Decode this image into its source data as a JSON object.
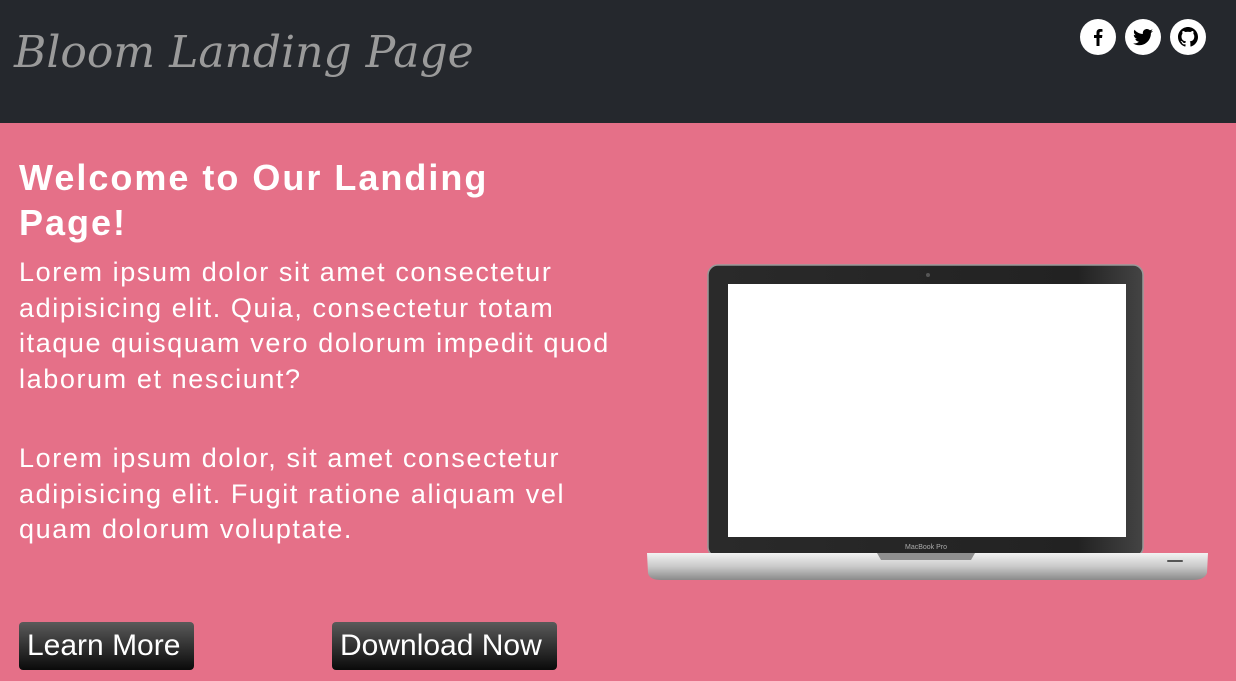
{
  "header": {
    "logo": "Bloom Landing Page",
    "social": [
      {
        "icon": "facebook-icon"
      },
      {
        "icon": "twitter-icon"
      },
      {
        "icon": "github-icon"
      }
    ]
  },
  "hero": {
    "title": "Welcome to Our Landing Page!",
    "paragraph1": "Lorem ipsum dolor sit amet consectetur adipisicing elit. Quia, consectetur totam itaque quisquam vero dolorum impedit quod laborum et nesciunt?",
    "paragraph2": "Lorem ipsum dolor, sit amet consectetur adipisicing elit. Fugit ratione aliquam vel quam dolorum voluptate.",
    "learn_more": "Learn More",
    "download_now": "Download Now",
    "laptop_brand": "MacBook Pro"
  },
  "colors": {
    "header_bg": "#25282d",
    "hero_bg": "#e57088",
    "logo_text": "#9a9a9a",
    "button_bg": "#1a1a1a"
  }
}
